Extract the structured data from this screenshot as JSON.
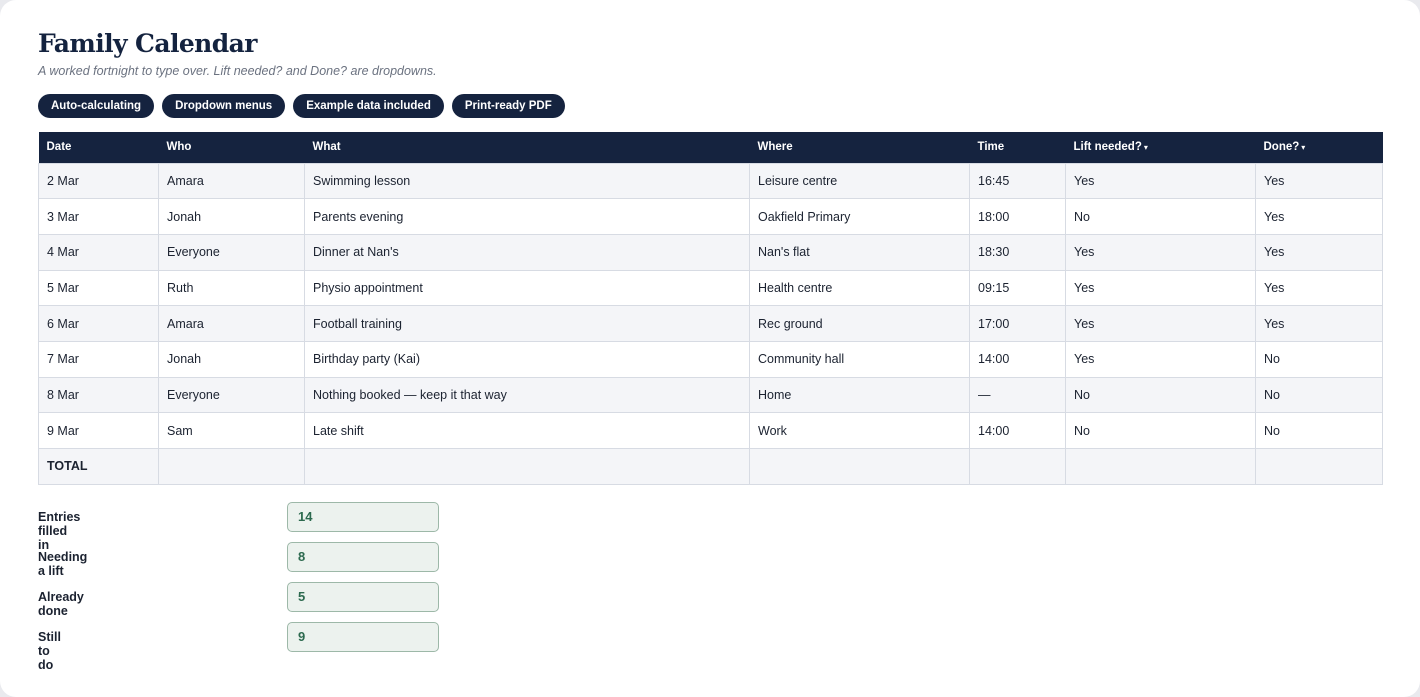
{
  "title": "Family Calendar",
  "subtitle": "A worked fortnight to type over. Lift needed? and Done? are dropdowns.",
  "badges": [
    "Auto-calculating",
    "Dropdown menus",
    "Example data included",
    "Print-ready PDF"
  ],
  "table": {
    "headers": [
      "Date",
      "Who",
      "What",
      "Where",
      "Time",
      "Lift needed?",
      "Done?"
    ],
    "dropdown_caret": "▾",
    "rows": [
      [
        "2 Mar",
        "Amara",
        "Swimming lesson",
        "Leisure centre",
        "16:45",
        "Yes",
        "Yes"
      ],
      [
        "3 Mar",
        "Jonah",
        "Parents evening",
        "Oakfield Primary",
        "18:00",
        "No",
        "Yes"
      ],
      [
        "4 Mar",
        "Everyone",
        "Dinner at Nan's",
        "Nan's flat",
        "18:30",
        "Yes",
        "Yes"
      ],
      [
        "5 Mar",
        "Ruth",
        "Physio appointment",
        "Health centre",
        "09:15",
        "Yes",
        "Yes"
      ],
      [
        "6 Mar",
        "Amara",
        "Football training",
        "Rec ground",
        "17:00",
        "Yes",
        "Yes"
      ],
      [
        "7 Mar",
        "Jonah",
        "Birthday party (Kai)",
        "Community hall",
        "14:00",
        "Yes",
        "No"
      ],
      [
        "8 Mar",
        "Everyone",
        "Nothing booked — keep it that way",
        "Home",
        "—",
        "No",
        "No"
      ],
      [
        "9 Mar",
        "Sam",
        "Late shift",
        "Work",
        "14:00",
        "No",
        "No"
      ]
    ],
    "total_label": "TOTAL"
  },
  "summary": [
    {
      "label": "Entries filled in",
      "value": "14"
    },
    {
      "label": "Needing a lift",
      "value": "8"
    },
    {
      "label": "Already done",
      "value": "5"
    },
    {
      "label": "Still to do",
      "value": "9"
    }
  ],
  "colors": {
    "navy": "#15233f",
    "summary_bg": "#ecf2ee",
    "summary_text": "#2d6a4f"
  }
}
